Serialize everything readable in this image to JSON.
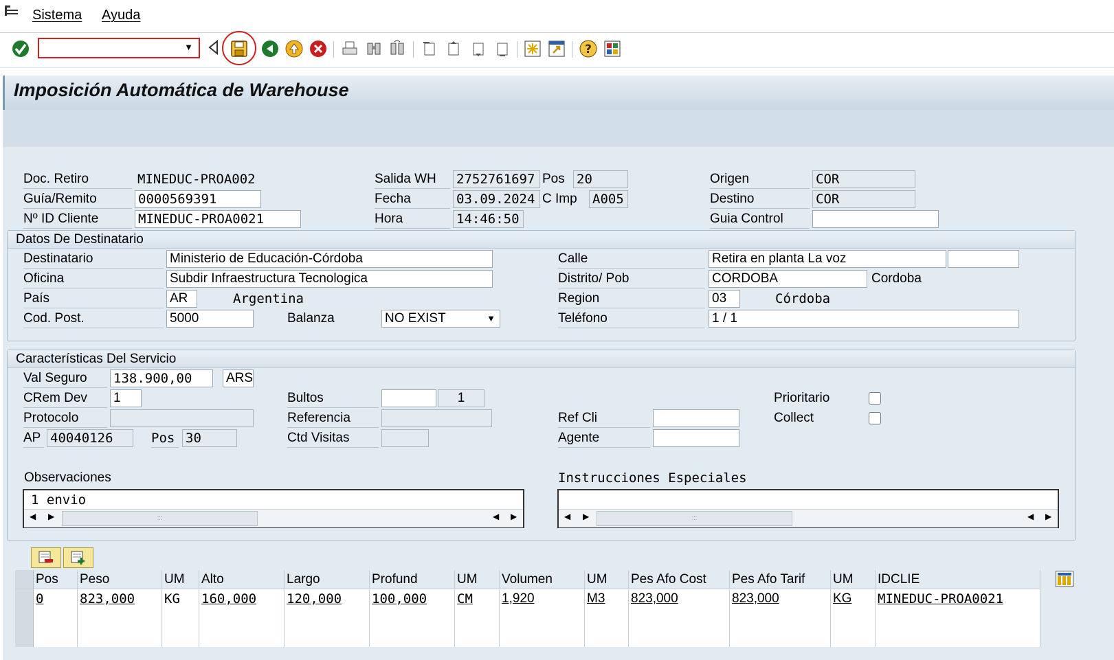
{
  "menu": {
    "sistema": "Sistema",
    "ayuda": "Ayuda"
  },
  "toolbar": {
    "command_value": ""
  },
  "title": "Imposición Automática de Warehouse",
  "header": {
    "doc_retiro_label": "Doc. Retiro",
    "doc_retiro_value": "MINEDUC-PROA002",
    "guia_label": "Guía/Remito",
    "guia_value": "0000569391",
    "idcliente_label": "Nº ID Cliente",
    "idcliente_value": "MINEDUC-PROA0021",
    "salida_label": "Salida WH",
    "salida_value": "2752761697",
    "pos_label": "Pos",
    "pos_value": "20",
    "fecha_label": "Fecha",
    "fecha_value": "03.09.2024",
    "cimp_label": "C Imp",
    "cimp_value": "A005",
    "hora_label": "Hora",
    "hora_value": "14:46:50",
    "origen_label": "Origen",
    "origen_value": "COR",
    "destino_label": "Destino",
    "destino_value": "COR",
    "guia_control_label": "Guia Control",
    "guia_control_value": ""
  },
  "destinatario": {
    "heading": "Datos De Destinatario",
    "destinatario_label": "Destinatario",
    "destinatario_value": "Ministerio de Educación-Córdoba",
    "oficina_label": "Oficina",
    "oficina_value": "Subdir Infraestructura Tecnologica",
    "pais_label": "País",
    "pais_code": "AR",
    "pais_name": "Argentina",
    "codpost_label": "Cod. Post.",
    "codpost_value": "5000",
    "balanza_label": "Balanza",
    "balanza_value": "NO EXIST",
    "calle_label": "Calle",
    "calle_value": "Retira en planta La voz",
    "calle_extra": "",
    "distrito_label": "Distrito/ Pob",
    "distrito_value": "CORDOBA",
    "distrito_text": "Cordoba",
    "region_label": "Region",
    "region_code": "03",
    "region_name": "Córdoba",
    "telefono_label": "Teléfono",
    "telefono_value": "1 / 1"
  },
  "servicio": {
    "heading": "Características Del Servicio",
    "valseguro_label": "Val Seguro",
    "valseguro_value": "138.900,00",
    "moneda": "ARS",
    "crem_label": "CRem Dev",
    "crem_value": "1",
    "protocolo_label": "Protocolo",
    "protocolo_value": "",
    "ap_label": "AP",
    "ap_value": "40040126",
    "appos_label": "Pos",
    "appos_value": "30",
    "bultos_label": "Bultos",
    "bultos_value1": "",
    "bultos_value2": "1",
    "referencia_label": "Referencia",
    "referencia_value": "",
    "ctdvisitas_label": "Ctd Visitas",
    "ctdvisitas_value": "",
    "refcli_label": "Ref Cli",
    "refcli_value": "",
    "agente_label": "Agente",
    "agente_value": "",
    "prioritario_label": "Prioritario",
    "collect_label": "Collect",
    "observaciones_label": "Observaciones",
    "observaciones_value": "1 envio",
    "instrucciones_label": "Instrucciones Especiales",
    "instrucciones_value": ""
  },
  "table": {
    "columns": [
      "Pos",
      "Peso",
      "UM",
      "Alto",
      "Largo",
      "Profund",
      "UM",
      "Volumen",
      "UM",
      "Pes Afo Cost",
      "Pes Afo Tarif",
      "UM",
      "IDCLIE"
    ],
    "rows": [
      [
        "0",
        "823,000",
        "KG",
        "160,000",
        "120,000",
        "100,000",
        "CM",
        "1,920",
        "M3",
        "823,000",
        "823,000",
        "KG",
        "MINEDUC-PROA0021"
      ]
    ]
  },
  "colors": {
    "highlight_circle": "#d21f1f",
    "workarea": "#e3ebf2"
  }
}
